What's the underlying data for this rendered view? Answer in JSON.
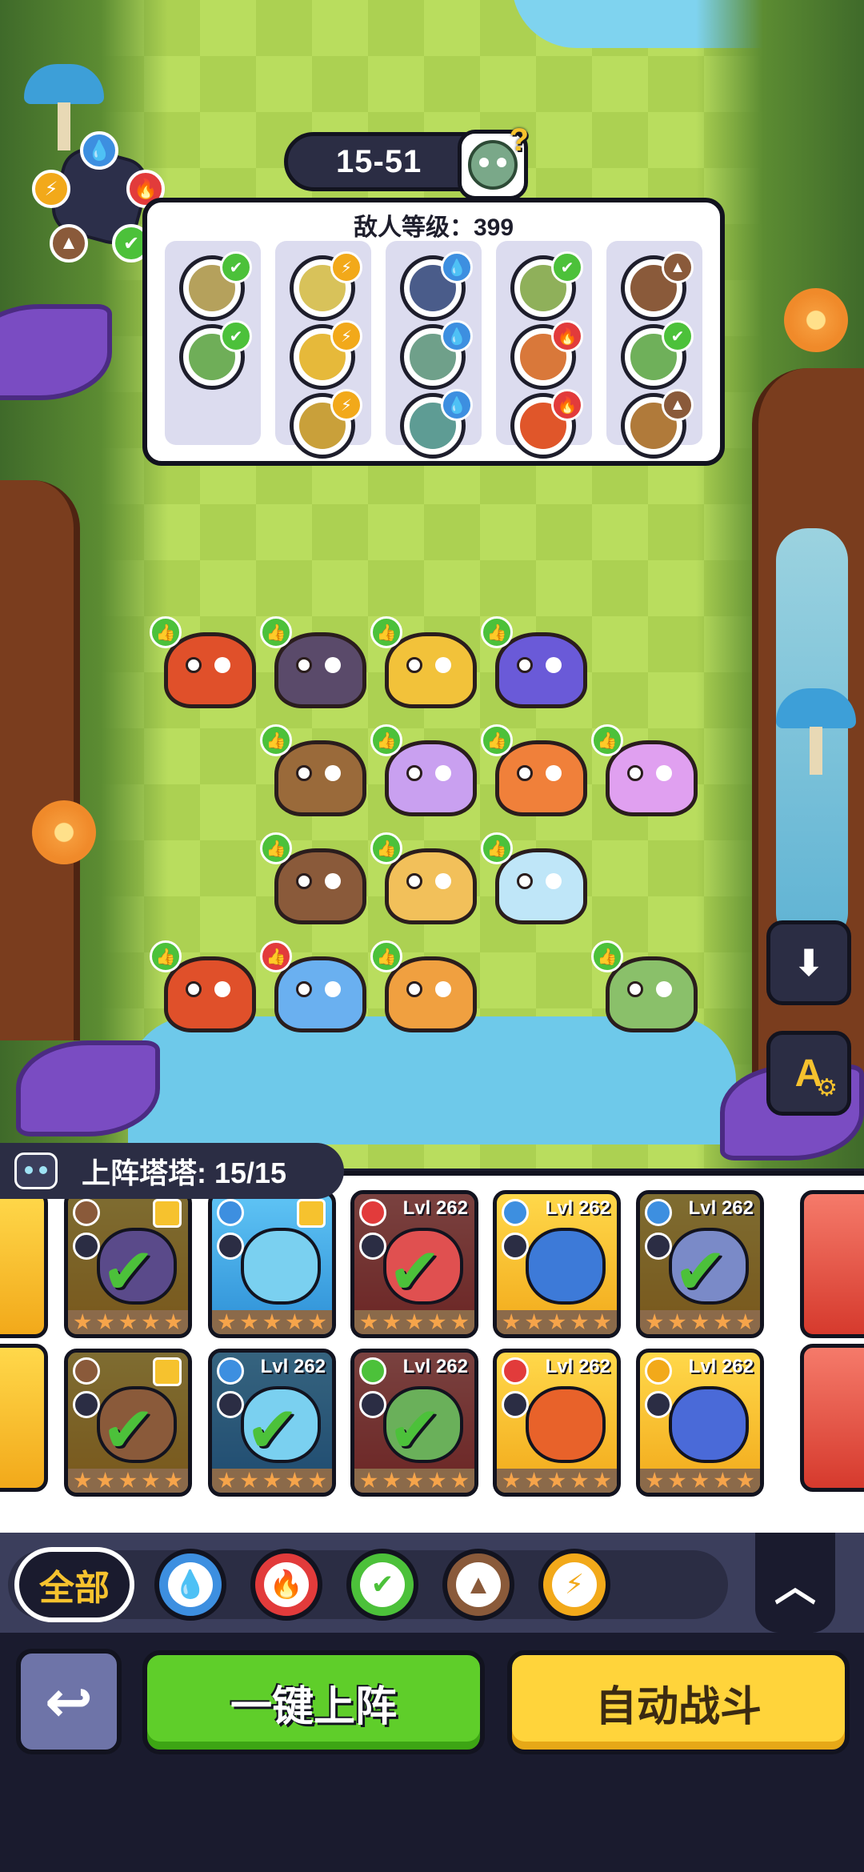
{
  "stage": {
    "label": "15-51"
  },
  "enemy_panel": {
    "title": "敌人等级：399",
    "columns": [
      [
        {
          "element": "nature",
          "color": "#b5a15c"
        },
        {
          "element": "nature",
          "color": "#6fae58"
        }
      ],
      [
        {
          "element": "lightning",
          "color": "#d8c25a"
        },
        {
          "element": "lightning",
          "color": "#e6b93a"
        },
        {
          "element": "lightning",
          "color": "#c9a03a"
        }
      ],
      [
        {
          "element": "water",
          "color": "#4a5c8a"
        },
        {
          "element": "water",
          "color": "#6fa08a"
        },
        {
          "element": "water",
          "color": "#5e9c94"
        }
      ],
      [
        {
          "element": "nature",
          "color": "#8fb05a"
        },
        {
          "element": "fire",
          "color": "#d9783a"
        },
        {
          "element": "fire",
          "color": "#e0562a"
        }
      ],
      [
        {
          "element": "earth",
          "color": "#8a5a3a"
        },
        {
          "element": "nature",
          "color": "#6fb05a"
        },
        {
          "element": "earth",
          "color": "#b07a3a"
        }
      ]
    ]
  },
  "element_colors": {
    "water": "#3d8fe0",
    "fire": "#e23b3b",
    "nature": "#4cc13a",
    "earth": "#8a5a3a",
    "lightning": "#f2a91a"
  },
  "deployed": {
    "label": "上阵塔塔: 15/15"
  },
  "roster": {
    "rows": [
      [
        {
          "level": "",
          "element": "earth",
          "tone": "gold",
          "dim": true,
          "checked": true,
          "fav": true,
          "creature": "#5a4a8a"
        },
        {
          "level": "",
          "element": "water",
          "tone": "blue",
          "dim": false,
          "checked": false,
          "fav": true,
          "creature": "#7ad0f0"
        },
        {
          "level": "Lvl 262",
          "element": "fire",
          "tone": "red",
          "dim": true,
          "checked": true,
          "fav": false,
          "creature": "#e05050"
        },
        {
          "level": "Lvl 262",
          "element": "water",
          "tone": "gold",
          "dim": false,
          "checked": false,
          "fav": false,
          "creature": "#3d7ad8"
        },
        {
          "level": "Lvl 262",
          "element": "water",
          "tone": "gold",
          "dim": true,
          "checked": true,
          "fav": false,
          "creature": "#7a8ac8"
        }
      ],
      [
        {
          "level": "",
          "element": "earth",
          "tone": "gold",
          "dim": true,
          "checked": true,
          "fav": true,
          "creature": "#8a5a3a"
        },
        {
          "level": "Lvl 262",
          "element": "water",
          "tone": "blue",
          "dim": true,
          "checked": true,
          "fav": false,
          "creature": "#7ad0f0"
        },
        {
          "level": "Lvl 262",
          "element": "nature",
          "tone": "red",
          "dim": true,
          "checked": true,
          "fav": false,
          "creature": "#6ab05a"
        },
        {
          "level": "Lvl 262",
          "element": "fire",
          "tone": "gold",
          "dim": false,
          "checked": false,
          "fav": false,
          "creature": "#e8622a"
        },
        {
          "level": "Lvl 262",
          "element": "lightning",
          "tone": "gold",
          "dim": false,
          "checked": false,
          "fav": false,
          "creature": "#4a6ad8"
        }
      ]
    ]
  },
  "filters": {
    "all_label": "全部",
    "items": [
      {
        "name": "water",
        "glyph": "💧"
      },
      {
        "name": "fire",
        "glyph": "🔥"
      },
      {
        "name": "nature",
        "glyph": "✔"
      },
      {
        "name": "earth",
        "glyph": "▲"
      },
      {
        "name": "lightning",
        "glyph": "⚡"
      }
    ],
    "collapse_glyph": "︿"
  },
  "actions": {
    "back_glyph": "↩",
    "deploy_label": "一键上阵",
    "auto_label": "自动战斗"
  },
  "side_buttons": {
    "download_glyph": "⬇",
    "auto_text_glyph": "A",
    "gear_glyph": "⚙"
  },
  "units": [
    {
      "color": "#e0502a",
      "badge": "green"
    },
    {
      "color": "#5a4a6a",
      "badge": "green"
    },
    {
      "color": "#f2c23a",
      "badge": "green"
    },
    {
      "color": "#6a5ad8",
      "badge": "green"
    },
    {
      "color": "#9a6a3a",
      "badge": "green"
    },
    {
      "color": "#c9a0f0",
      "badge": "green"
    },
    {
      "color": "#f0803a",
      "badge": "green"
    },
    {
      "color": "#e0a0f0",
      "badge": "green"
    },
    {
      "color": "#8a5a3a",
      "badge": "green"
    },
    {
      "color": "#f2c05a",
      "badge": "green"
    },
    {
      "color": "#bfe6f8",
      "badge": "green"
    },
    {
      "color": "#e0502a",
      "badge": "green"
    },
    {
      "color": "#6ab0f0",
      "badge": "red"
    },
    {
      "color": "#f0a040",
      "badge": "green"
    },
    {
      "color": "#8ac06a",
      "badge": "green"
    }
  ]
}
